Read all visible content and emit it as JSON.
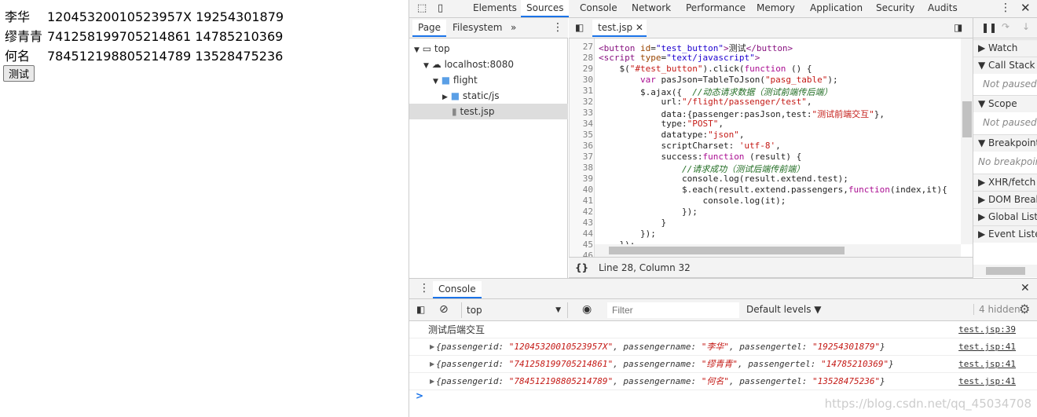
{
  "page": {
    "rows": [
      [
        "李华",
        "12045320010523957X",
        "19254301879"
      ],
      [
        "缪青青",
        "741258199705214861",
        "14785210369"
      ],
      [
        "何名",
        "784512198805214789",
        "13528475236"
      ]
    ],
    "button": "测试"
  },
  "devtools": {
    "tabs": [
      "Elements",
      "Sources",
      "Console",
      "Network",
      "Performance",
      "Memory",
      "Application",
      "Security",
      "Audits"
    ],
    "active_tab": "Sources",
    "navigator": {
      "tabs": [
        "Page",
        "Filesystem"
      ],
      "more": "»",
      "tree": [
        "top",
        "localhost:8080",
        "flight",
        "static/js",
        "test.jsp"
      ]
    },
    "editor": {
      "file_tab": "test.jsp",
      "status": "Line 28, Column 32",
      "format_icon": "{}",
      "line_numbers": [
        "27",
        "28",
        "29",
        "30",
        "31",
        "32",
        "33",
        "34",
        "35",
        "36",
        "37",
        "38",
        "39",
        "40",
        "41",
        "42",
        "43",
        "44",
        "45",
        "46"
      ]
    },
    "debugger": {
      "sections": [
        "Watch",
        "Call Stack",
        "Scope",
        "Breakpoints",
        "XHR/fetch Breakpoints",
        "DOM Breakpoints",
        "Global Listeners",
        "Event Listeners"
      ],
      "not_paused": "Not paused",
      "no_breakpoints": "No breakpoints"
    },
    "drawer": {
      "tab": "Console",
      "context": "top",
      "filter_placeholder": "Filter",
      "levels": "Default levels ▼",
      "hidden": "4 hidden",
      "messages": [
        {
          "text": "测试后端交互",
          "src": "test.jsp:39"
        },
        {
          "id": "12045320010523957X",
          "name": "李华",
          "tel": "19254301879",
          "src": "test.jsp:41"
        },
        {
          "id": "741258199705214861",
          "name": "缪青青",
          "tel": "14785210369",
          "src": "test.jsp:41"
        },
        {
          "id": "784512198805214789",
          "name": "何名",
          "tel": "13528475236",
          "src": "test.jsp:41"
        }
      ],
      "prompt": ">"
    },
    "watermark": "https://blog.csdn.net/qq_45034708",
    "accent": "#1a73e8"
  }
}
